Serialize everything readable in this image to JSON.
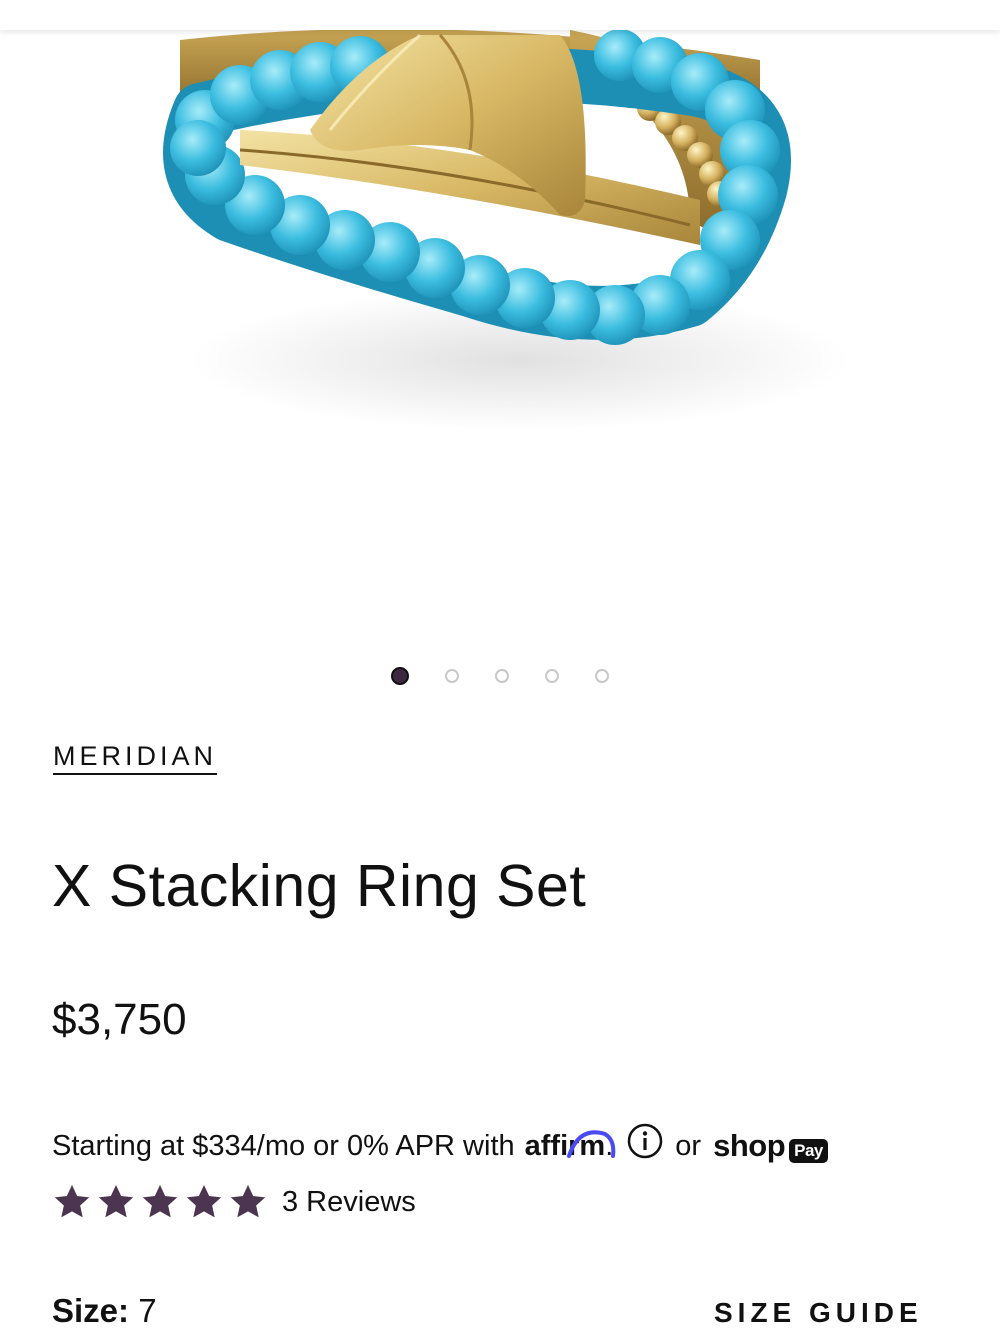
{
  "gallery": {
    "image_alt": "X Stacking Ring Set",
    "dots": [
      {
        "label": "Image 1",
        "active": true
      },
      {
        "label": "Image 2",
        "active": false
      },
      {
        "label": "Image 3",
        "active": false
      },
      {
        "label": "Image 4",
        "active": false
      },
      {
        "label": "Image 5",
        "active": false
      }
    ]
  },
  "product": {
    "brand": "MERIDIAN",
    "title": "X Stacking Ring Set",
    "price": "$3,750"
  },
  "financing": {
    "text": "Starting at $334/mo or 0% APR with",
    "affirm_logo": "affirm",
    "affirm_period": ".",
    "or": "or",
    "shop_logo": "shop",
    "pay_badge": "Pay"
  },
  "rating": {
    "stars": 5,
    "reviews": "3 Reviews",
    "star_color": "#4b3550"
  },
  "size": {
    "label": "Size:",
    "value": "7",
    "guide": "SIZE GUIDE"
  }
}
